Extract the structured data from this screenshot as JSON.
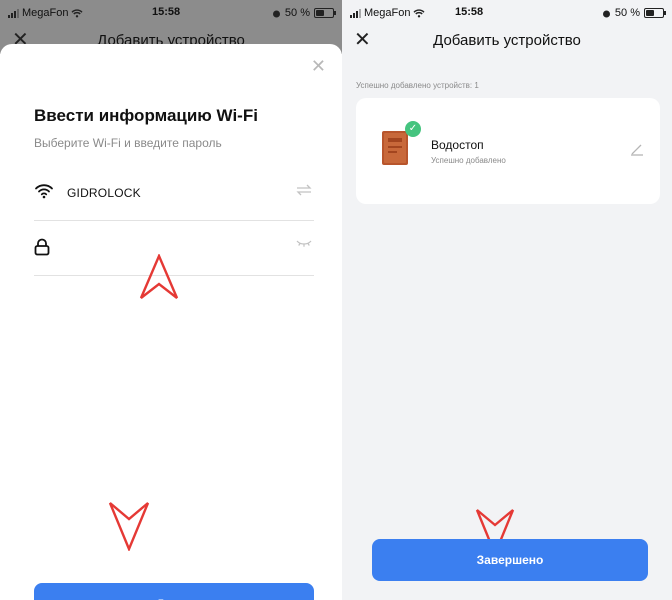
{
  "status": {
    "carrier": "MegaFon",
    "time": "15:58",
    "battery": "50 %",
    "battery_level": 0.5
  },
  "left": {
    "nav_title": "Добавить устройство",
    "title": "Ввести информацию Wi-Fi",
    "subtitle": "Выберите Wi-Fi и введите пароль",
    "ssid": "GIDROLOCK",
    "password": "",
    "next_label": "Далее"
  },
  "right": {
    "nav_title": "Добавить устройство",
    "success_count": "Успешно добавлено устройств: 1",
    "device_name": "Водостоп",
    "device_status": "Успешно добавлено",
    "done_label": "Завершено"
  },
  "icons": {
    "close": "close-icon",
    "wifi": "wifi-icon",
    "lock": "lock-icon",
    "switch": "switch-arrows-icon",
    "eye": "eye-closed-icon",
    "edit": "edit-icon",
    "check": "check-icon"
  },
  "colors": {
    "primary": "#3b7ff0",
    "annotation": "#e53935",
    "success": "#45c47f",
    "dim": "#8c8c8c"
  }
}
